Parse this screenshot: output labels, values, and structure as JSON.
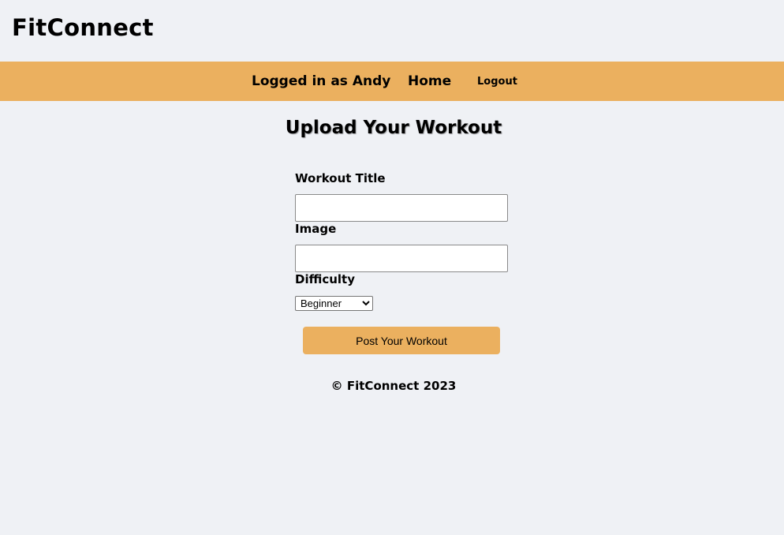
{
  "header": {
    "brand": "FitConnect"
  },
  "nav": {
    "user_status": "Logged in as Andy",
    "home": "Home",
    "logout": "Logout"
  },
  "main": {
    "title": "Upload Your Workout",
    "form": {
      "title_label": "Workout Title",
      "title_value": "",
      "image_label": "Image",
      "image_value": "",
      "difficulty_label": "Difficulty",
      "difficulty_selected": "Beginner",
      "submit_label": "Post Your Workout"
    }
  },
  "footer": {
    "text": "© FitConnect 2023"
  },
  "colors": {
    "background": "#eff1f5",
    "accent": "#ebb05f"
  }
}
